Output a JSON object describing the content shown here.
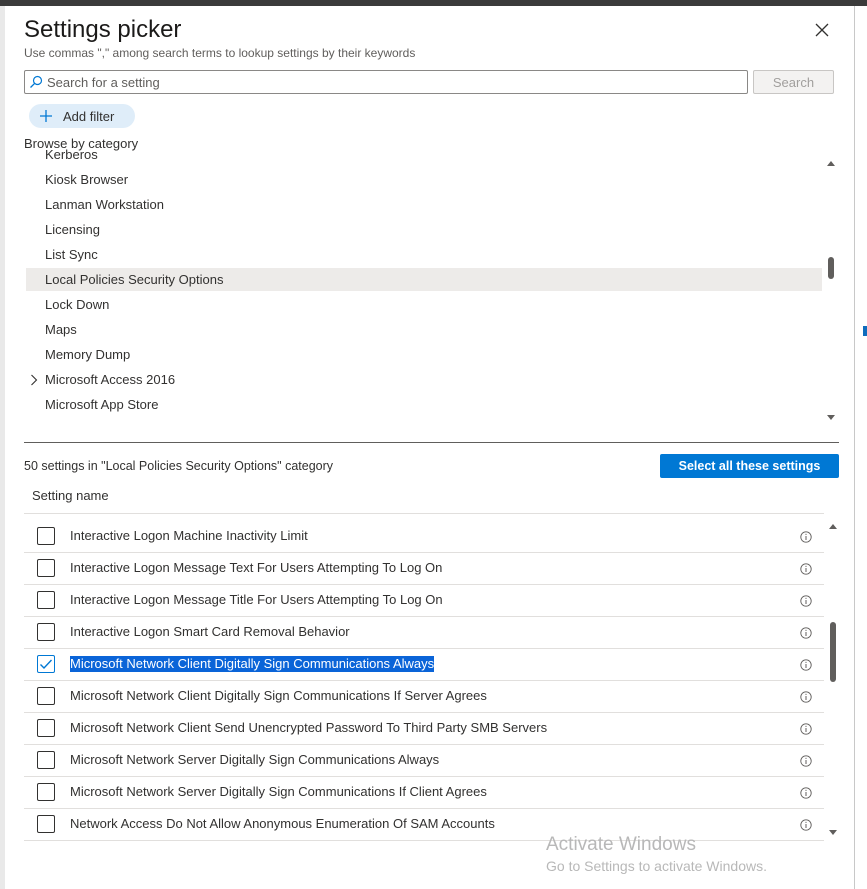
{
  "dialog": {
    "title": "Settings picker",
    "subtitle": "Use commas \",\" among search terms to lookup settings by their keywords",
    "search_placeholder": "Search for a setting",
    "search_button": "Search",
    "add_filter": "Add filter",
    "browse_label": "Browse by category"
  },
  "categories": [
    {
      "label": "Kerberos",
      "selected": false,
      "expandable": false
    },
    {
      "label": "Kiosk Browser",
      "selected": false,
      "expandable": false
    },
    {
      "label": "Lanman Workstation",
      "selected": false,
      "expandable": false
    },
    {
      "label": "Licensing",
      "selected": false,
      "expandable": false
    },
    {
      "label": "List Sync",
      "selected": false,
      "expandable": false
    },
    {
      "label": "Local Policies Security Options",
      "selected": true,
      "expandable": false
    },
    {
      "label": "Lock Down",
      "selected": false,
      "expandable": false
    },
    {
      "label": "Maps",
      "selected": false,
      "expandable": false
    },
    {
      "label": "Memory Dump",
      "selected": false,
      "expandable": false
    },
    {
      "label": "Microsoft Access 2016",
      "selected": false,
      "expandable": true
    },
    {
      "label": "Microsoft App Store",
      "selected": false,
      "expandable": false
    }
  ],
  "settings_section": {
    "count_label": "50 settings in \"Local Policies Security Options\" category",
    "select_all_button": "Select all these settings",
    "column_header": "Setting name"
  },
  "settings": [
    {
      "label": "Interactive Logon Machine Inactivity Limit",
      "checked": false
    },
    {
      "label": "Interactive Logon Message Text For Users Attempting To Log On",
      "checked": false
    },
    {
      "label": "Interactive Logon Message Title For Users Attempting To Log On",
      "checked": false
    },
    {
      "label": "Interactive Logon Smart Card Removal Behavior",
      "checked": false
    },
    {
      "label": "Microsoft Network Client Digitally Sign Communications Always",
      "checked": true
    },
    {
      "label": "Microsoft Network Client Digitally Sign Communications If Server Agrees",
      "checked": false
    },
    {
      "label": "Microsoft Network Client Send Unencrypted Password To Third Party SMB Servers",
      "checked": false
    },
    {
      "label": "Microsoft Network Server Digitally Sign Communications Always",
      "checked": false
    },
    {
      "label": "Microsoft Network Server Digitally Sign Communications If Client Agrees",
      "checked": false
    },
    {
      "label": "Network Access Do Not Allow Anonymous Enumeration Of SAM Accounts",
      "checked": false
    }
  ],
  "watermark": {
    "line1": "Activate Windows",
    "line2": "Go to Settings to activate Windows."
  },
  "colors": {
    "accent": "#0078d4",
    "selected_row": "#edebe9",
    "text_highlight": "#0a64d8"
  },
  "icons": {
    "close": "close-icon",
    "search": "search-icon",
    "add": "plus-icon",
    "expand": "chevron-right-icon",
    "info": "info-icon",
    "check": "checkmark-icon"
  }
}
